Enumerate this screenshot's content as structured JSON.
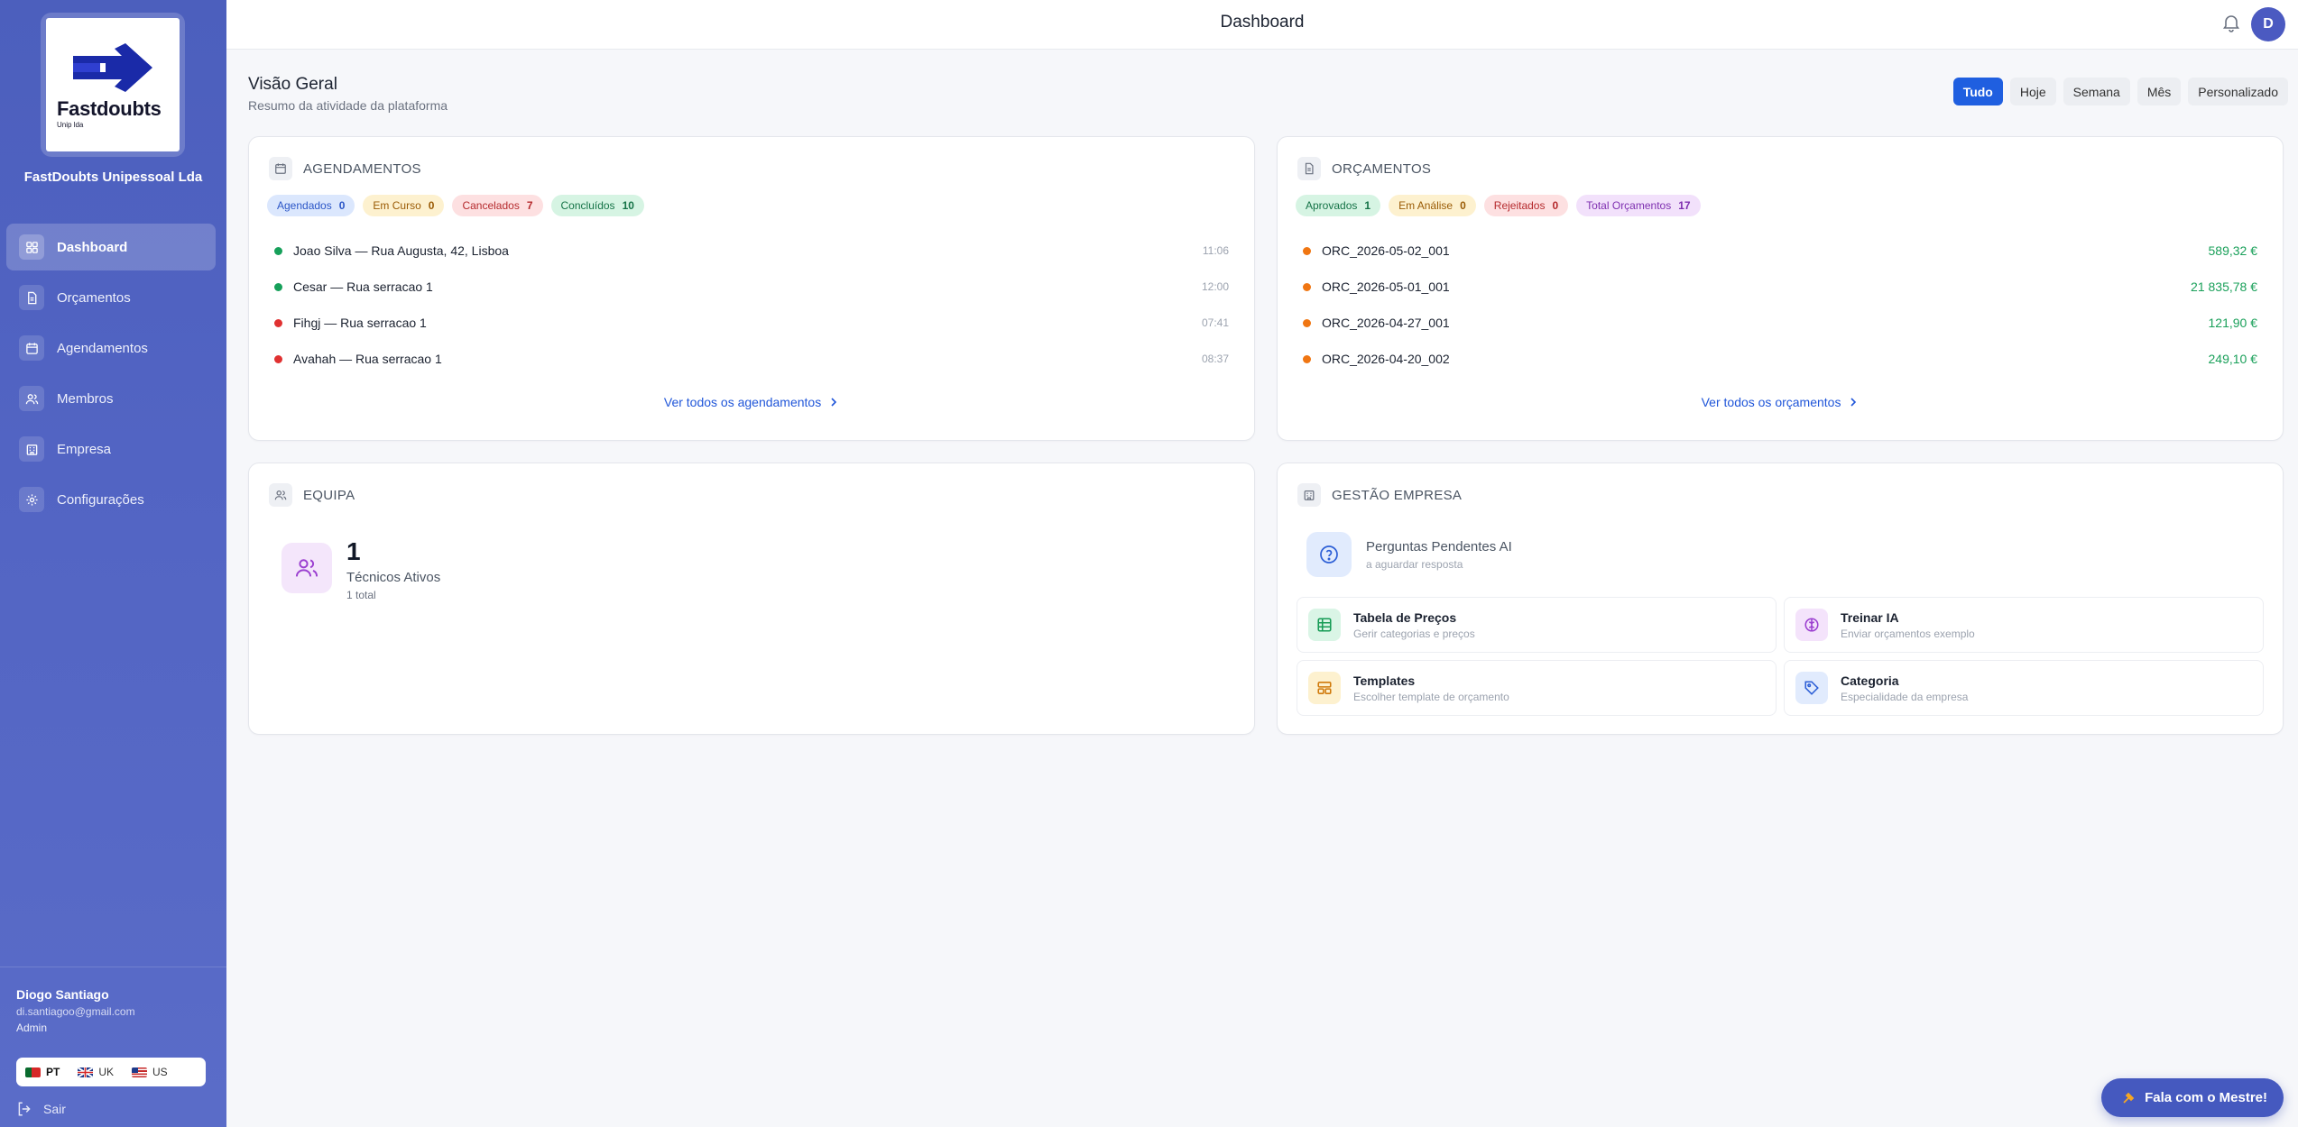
{
  "sidebar": {
    "logo_text": "Fastdoubts",
    "logo_sub": "Unip lda",
    "company": "FastDoubts Unipessoal Lda",
    "items": [
      {
        "label": "Dashboard",
        "icon": "grid-icon"
      },
      {
        "label": "Orçamentos",
        "icon": "document-icon"
      },
      {
        "label": "Agendamentos",
        "icon": "calendar-icon"
      },
      {
        "label": "Membros",
        "icon": "users-icon"
      },
      {
        "label": "Empresa",
        "icon": "building-icon"
      },
      {
        "label": "Configurações",
        "icon": "gear-icon"
      }
    ],
    "user": {
      "name": "Diogo Santiago",
      "email": "di.santiagoo@gmail.com",
      "role": "Admin"
    },
    "languages": [
      {
        "code": "PT"
      },
      {
        "code": "UK"
      },
      {
        "code": "US"
      }
    ],
    "logout": "Sair"
  },
  "topbar": {
    "title": "Dashboard",
    "avatar_initial": "D"
  },
  "overview": {
    "title": "Visão Geral",
    "subtitle": "Resumo da atividade da plataforma",
    "filters": [
      "Tudo",
      "Hoje",
      "Semana",
      "Mês",
      "Personalizado"
    ]
  },
  "appointments": {
    "title": "AGENDAMENTOS",
    "badges": [
      {
        "label": "Agendados",
        "count": "0"
      },
      {
        "label": "Em Curso",
        "count": "0"
      },
      {
        "label": "Cancelados",
        "count": "7"
      },
      {
        "label": "Concluídos",
        "count": "10"
      }
    ],
    "rows": [
      {
        "label": "Joao Silva — Rua Augusta, 42, Lisboa",
        "time": "11:06",
        "color": "#16a05a"
      },
      {
        "label": "Cesar — Rua serracao 1",
        "time": "12:00",
        "color": "#16a05a"
      },
      {
        "label": "Fihgj — Rua serracao 1",
        "time": "07:41",
        "color": "#e03131"
      },
      {
        "label": "Avahah — Rua serracao 1",
        "time": "08:37",
        "color": "#e03131"
      }
    ],
    "view_all": "Ver todos os agendamentos"
  },
  "budgets": {
    "title": "ORÇAMENTOS",
    "badges": [
      {
        "label": "Aprovados",
        "count": "1"
      },
      {
        "label": "Em Análise",
        "count": "0"
      },
      {
        "label": "Rejeitados",
        "count": "0"
      },
      {
        "label": "Total Orçamentos",
        "count": "17"
      }
    ],
    "rows": [
      {
        "label": "ORC_2026-05-02_001",
        "value": "589,32 €"
      },
      {
        "label": "ORC_2026-05-01_001",
        "value": "21 835,78 €"
      },
      {
        "label": "ORC_2026-04-27_001",
        "value": "121,90 €"
      },
      {
        "label": "ORC_2026-04-20_002",
        "value": "249,10 €"
      }
    ],
    "view_all": "Ver todos os orçamentos"
  },
  "team": {
    "title": "EQUIPA",
    "count": "1",
    "label": "Técnicos Ativos",
    "total": "1 total"
  },
  "company_mgmt": {
    "title": "GESTÃO EMPRESA",
    "pending_title": "Perguntas Pendentes AI",
    "pending_sub": "a aguardar resposta",
    "tiles": [
      {
        "title": "Tabela de Preços",
        "sub": "Gerir categorias e preços"
      },
      {
        "title": "Treinar IA",
        "sub": "Enviar orçamentos exemplo"
      },
      {
        "title": "Templates",
        "sub": "Escolher template de orçamento"
      },
      {
        "title": "Categoria",
        "sub": "Especialidade da empresa"
      }
    ]
  },
  "fab": {
    "label": "Fala com o Mestre!"
  },
  "colors": {
    "primary": "#1f5fe0",
    "sidebar": "#5264c3",
    "success": "#16a05a",
    "danger": "#e03131",
    "orange": "#f07612"
  }
}
